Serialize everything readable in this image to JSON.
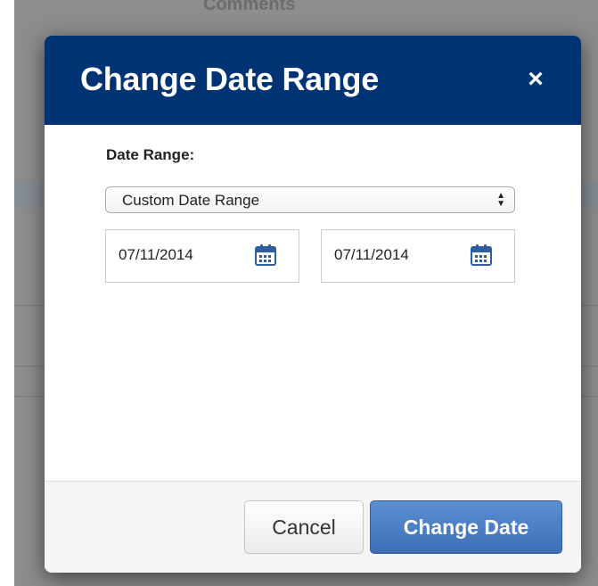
{
  "background": {
    "heading": "Comments"
  },
  "modal": {
    "title": "Change Date Range",
    "close_glyph": "×",
    "date_range_label": "Date Range:",
    "range_select_value": "Custom Date Range",
    "start_date": "07/11/2014",
    "end_date": "07/11/2014",
    "cancel_label": "Cancel",
    "submit_label": "Change Date"
  },
  "colors": {
    "header": "#003374",
    "primary_button": "#4a7dc3",
    "calendar_icon": "#2e5ea0"
  },
  "icons": {
    "close": "close-icon",
    "calendar": "calendar-icon",
    "select": "select-arrows-icon"
  }
}
